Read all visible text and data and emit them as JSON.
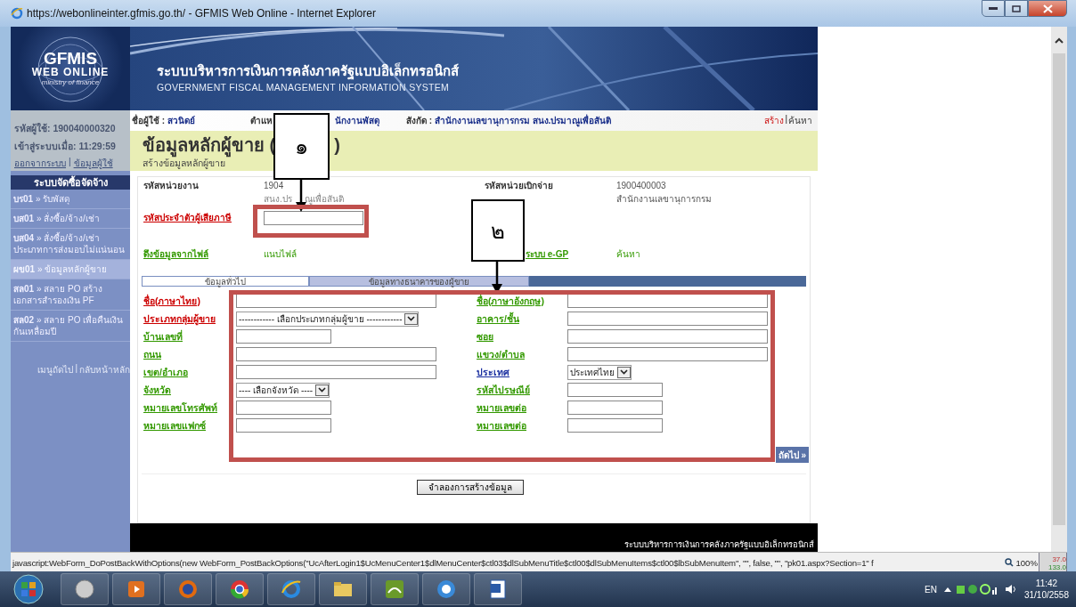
{
  "window": {
    "title": "https://webonlineinter.gfmis.go.th/ - GFMIS Web Online - Internet Explorer"
  },
  "logo": {
    "title": "GFMIS",
    "subtitle": "WEB ONLINE",
    "tagline": "ministry of finance"
  },
  "banner": {
    "title_th": "ระบบบริหารการเงินการคลังภาครัฐแบบอิเล็กทรอนิกส์",
    "title_en": "GOVERNMENT FISCAL MANAGEMENT INFORMATION SYSTEM"
  },
  "user_panel": {
    "user_id": "รหัสผู้ใช้: 190040000320",
    "login_time": "เข้าสู่ระบบเมื่อ: 11:29:59",
    "links": [
      "ออกจากระบบ",
      "ข้อมูลผู้ใช้"
    ],
    "separator": "|"
  },
  "menu": {
    "title": "ระบบจัดซื้อจัดจ้าง",
    "items": [
      {
        "text": "**บร01** » รับพัสดุ",
        "selected": false
      },
      {
        "text": "**บส01** » สั่งซื้อ/จ้าง/เช่า",
        "selected": false
      },
      {
        "text": "**บส04** » สั่งซื้อ/จ้าง/เช่า ประเภทการส่งมอบไม่แน่นอน",
        "selected": false
      },
      {
        "text": "**ผข01** » ข้อมูลหลักผู้ขาย",
        "selected": true
      },
      {
        "text": "**สล01** » สลาย PO สร้างเอกสารสำรองเงิน PF",
        "selected": false
      },
      {
        "text": "**สล02** » สลาย PO เพื่อคืนเงินกันเหลื่อมปี",
        "selected": false
      }
    ],
    "footer_links": [
      "เมนูถัดไป",
      "กลับหน้าหลัก"
    ],
    "separator": "|"
  },
  "user_bar": {
    "name_label": "ชื่อผู้ใช้ :",
    "name": "สวนิดย์",
    "position_label": "ตำแห",
    "position": "นักงานพัสดุ",
    "unit_label": "สังกัด :",
    "unit": "สำนักงานเลขานุการกรม สนง.ปรมาณูเพื่อสันติ",
    "actions": [
      {
        "label": "สร้าง",
        "selected": true
      },
      {
        "label": "ค้นหา",
        "selected": false
      }
    ],
    "separator": "|"
  },
  "page_header": {
    "title": "ข้อมูลหลักผู้ขาย (",
    "title_end": ")",
    "subtitle": "สร้างข้อมูลหลักผู้ขาย"
  },
  "info": {
    "unit_code_label": "รหัสหน่วยงาน",
    "unit_code": "1904",
    "unit_name": "สนง.ปร",
    "unit_name_end": "ณูเพื่อสันติ",
    "pay_code_label": "รหัสหน่วยเบิกจ่าย",
    "pay_code": "1900400003",
    "pay_name": "สำนักงานเลขานุการกรม",
    "tax_id_label": "รหัสประจำตัวผู้เสียภาษี",
    "file_label": "ดึงข้อมูลจากไฟล์",
    "file_action": "แนบไฟล์",
    "egp_label": "ระบบ e-GP",
    "egp_action": "ค้นหา"
  },
  "tabs": [
    {
      "label": "ข้อมูลทั่วไป",
      "selected": true
    },
    {
      "label": "ข้อมูลทางธนาคารของผู้ขาย",
      "selected": false
    }
  ],
  "fields": [
    {
      "label": "ชื่อ(ภาษาไทย)",
      "color": "#cc0000",
      "kind": "text"
    },
    {
      "label": "ชื่อ(ภาษาอังกฤษ)",
      "color": "#339900",
      "kind": "text"
    },
    {
      "label": "ประเภทกลุ่มผู้ขาย",
      "color": "#cc0000",
      "kind": "select",
      "value": "------------ เลือกประเภทกลุ่มผู้ขาย ------------"
    },
    {
      "label": "อาคาร/ชั้น",
      "color": "#339900",
      "kind": "text"
    },
    {
      "label": "บ้านเลขที่",
      "color": "#339900",
      "kind": "short"
    },
    {
      "label": "ซอย",
      "color": "#339900",
      "kind": "text"
    },
    {
      "label": "ถนน",
      "color": "#339900",
      "kind": "text"
    },
    {
      "label": "แขวง/ตำบล",
      "color": "#339900",
      "kind": "text"
    },
    {
      "label": "เขต/อำเภอ",
      "color": "#339900",
      "kind": "text"
    },
    {
      "label": "ประเทศ",
      "color": "#1a2fa0",
      "kind": "select",
      "value": "ประเทศไทย"
    },
    {
      "label": "จังหวัด",
      "color": "#339900",
      "kind": "select",
      "value": "---- เลือกจังหวัด ----"
    },
    {
      "label": "รหัสไปรษณีย์",
      "color": "#339900",
      "kind": "short"
    },
    {
      "label": "หมายเลขโทรศัพท์",
      "color": "#339900",
      "kind": "short"
    },
    {
      "label": "หมายเลขต่อ",
      "color": "#339900",
      "kind": "short"
    },
    {
      "label": "หมายเลขแฟกซ์",
      "color": "#339900",
      "kind": "short"
    },
    {
      "label": "หมายเลขต่อ",
      "color": "#339900",
      "kind": "short"
    }
  ],
  "next_button": "ถัดไป »",
  "save_button": "จำลองการสร้างข้อมูล",
  "footer": "ระบบบริหารการเงินการคลังภาครัฐแบบอิเล็กทรอนิกส์",
  "callouts": [
    {
      "label": "๑"
    },
    {
      "label": "๒"
    }
  ],
  "status_bar": {
    "text": "javascript:WebForm_DoPostBackWithOptions(new WebForm_PostBackOptions(\"UcAfterLogin1$UcMenuCenter1$dlMenuCenter$ctl03$dlSubMenuTitle$ctl00$dlSubMenuItems$ctl00$lbSubMenuItem\", \"\", false, \"\", \"pk01.aspx?Section=1\" f",
    "zoom": "100%"
  },
  "gadget": [
    "37.0",
    "133.0"
  ],
  "taskbar": {
    "language": "EN",
    "time": "11:42",
    "date": "31/10/2558"
  }
}
